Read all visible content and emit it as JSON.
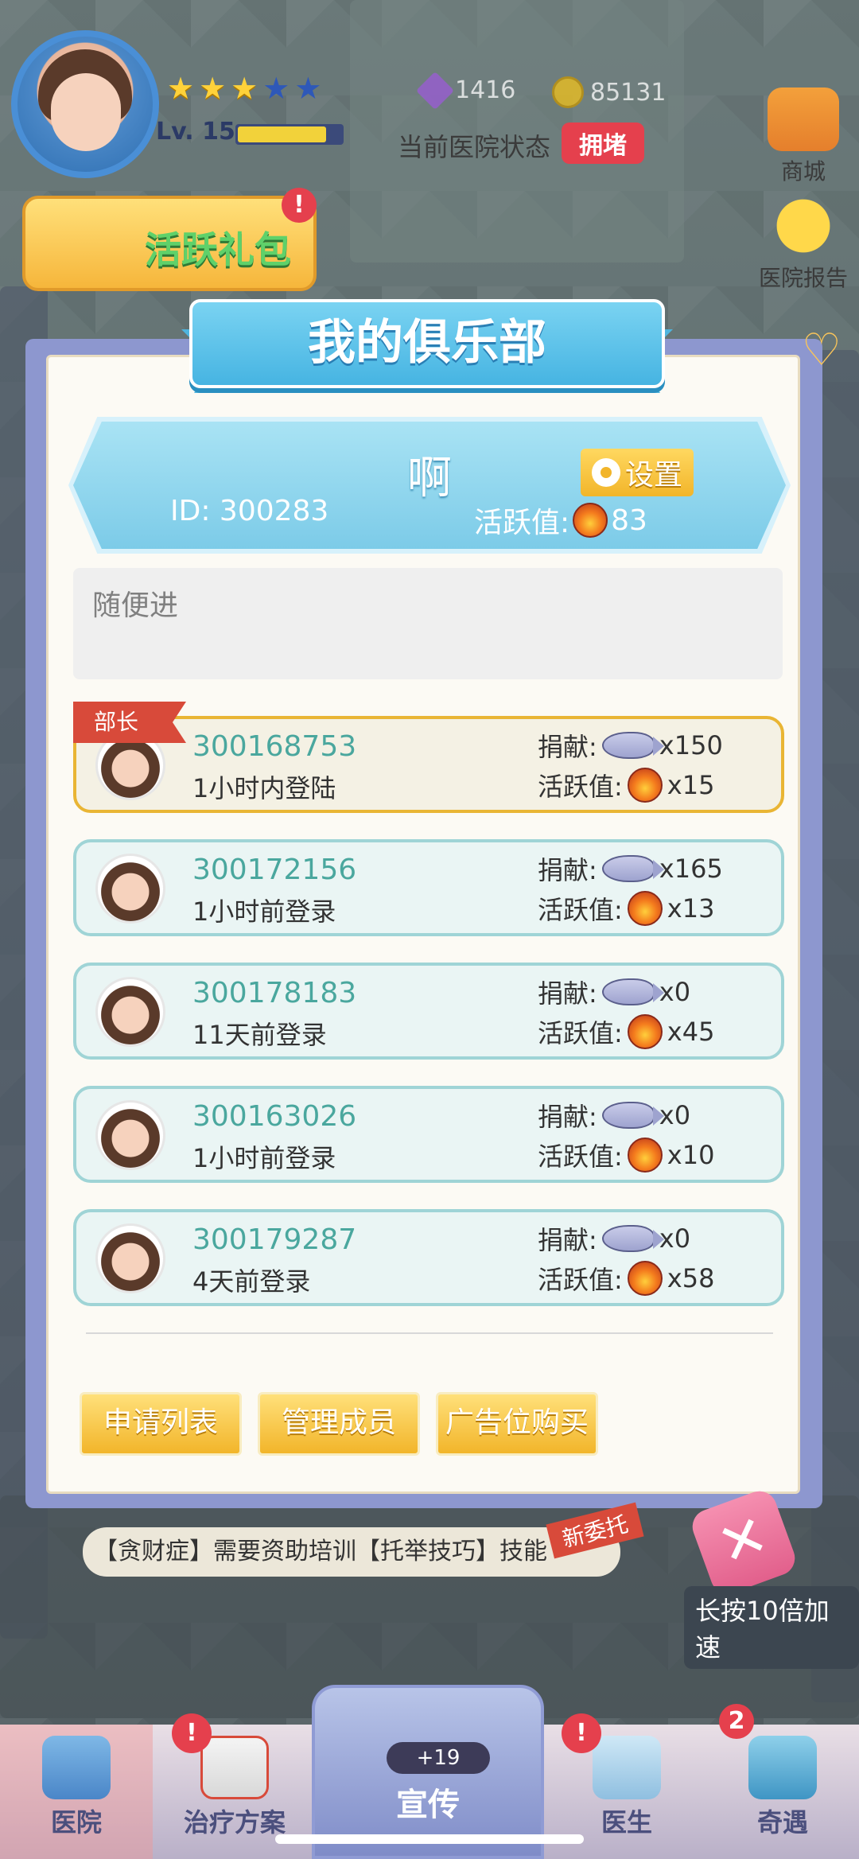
{
  "hud": {
    "level_label": "Lv. 15",
    "level_progress": 0.85,
    "stars_on": 3,
    "stars_total": 5,
    "gems": "1416",
    "coins": "85131",
    "hospital_status_label": "当前医院状态",
    "hospital_status_value": "拥堵",
    "gift_pack_label": "活跃礼包",
    "gift_badge": "!",
    "shop_label": "商城",
    "report_label": "医院报告"
  },
  "modal": {
    "title": "我的俱乐部",
    "club_name": "啊",
    "club_id": "ID: 300283",
    "activity_label": "活跃值:",
    "activity_value": "83",
    "settings_label": "设置",
    "description": "随便进",
    "leader_tag": "部长",
    "donate_label": "捐献:",
    "active_label": "活跃值:",
    "members": [
      {
        "id": "300168753",
        "login": "1小时内登陆",
        "donate": "x150",
        "active": "x15"
      },
      {
        "id": "300172156",
        "login": "1小时前登录",
        "donate": "x165",
        "active": "x13"
      },
      {
        "id": "300178183",
        "login": "11天前登录",
        "donate": "x0",
        "active": "x45"
      },
      {
        "id": "300163026",
        "login": "1小时前登录",
        "donate": "x0",
        "active": "x10"
      },
      {
        "id": "300179287",
        "login": "4天前登录",
        "donate": "x0",
        "active": "x58"
      }
    ],
    "buttons": {
      "apply_list": "申请列表",
      "manage_members": "管理成员",
      "ad_purchase": "广告位购买"
    }
  },
  "notice": {
    "text": "【贪财症】需要资助培训【托举技巧】技能",
    "tag": "新委托"
  },
  "speed_label": "长按10倍加速",
  "nav": {
    "hospital": "医院",
    "treatment": "治疗方案",
    "promo": "宣传",
    "promo_count": "+19",
    "doctor": "医生",
    "encounter": "奇遇",
    "encounter_badge": "2",
    "alert_badge": "!"
  },
  "colors": {
    "modal_frame": "#8d97cf",
    "title_ribbon": "#46b4e2",
    "leader_border": "#e9b534",
    "member_border": "#9fd4d6",
    "member_id": "#4aa79e",
    "button_gold": "#f2b52a",
    "status_red": "#e5404d"
  }
}
